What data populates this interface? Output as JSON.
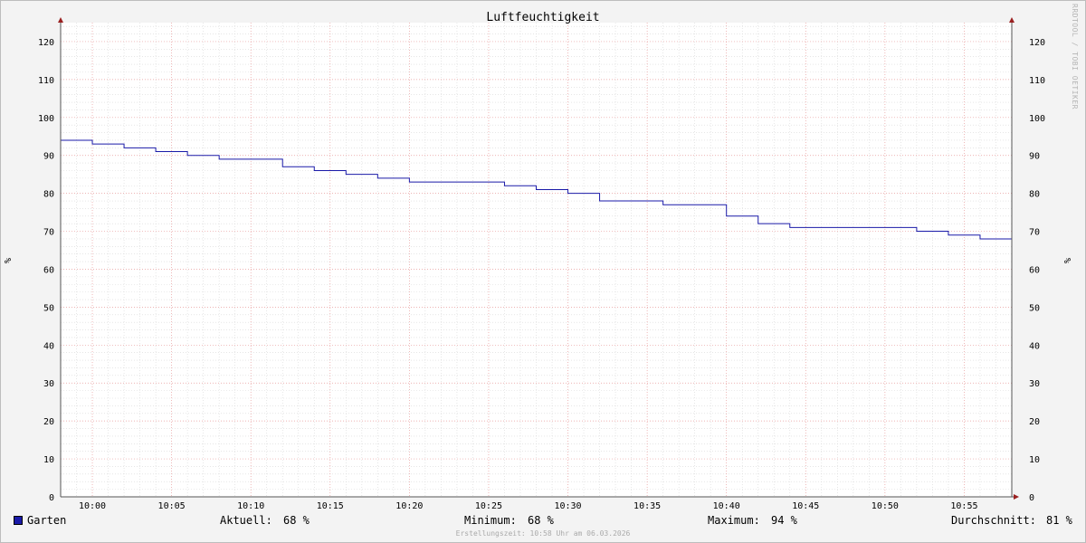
{
  "chart_data": {
    "type": "line",
    "title": "Luftfeuchtigkeit",
    "ylabel": "%",
    "ylim": [
      0,
      125
    ],
    "yticks": [
      0,
      10,
      20,
      30,
      40,
      50,
      60,
      70,
      80,
      90,
      100,
      110,
      120
    ],
    "xlim_minutes": [
      58,
      118
    ],
    "xticks": [
      "10:00",
      "10:05",
      "10:10",
      "10:15",
      "10:20",
      "10:25",
      "10:30",
      "10:35",
      "10:40",
      "10:45",
      "10:50",
      "10:55"
    ],
    "grid": true,
    "series": [
      {
        "name": "Garten",
        "color": "#1a1aa8",
        "step_points": [
          [
            "09:58",
            94
          ],
          [
            "10:00",
            93
          ],
          [
            "10:02",
            92
          ],
          [
            "10:04",
            91
          ],
          [
            "10:06",
            90
          ],
          [
            "10:08",
            89
          ],
          [
            "10:12",
            87
          ],
          [
            "10:14",
            86
          ],
          [
            "10:16",
            85
          ],
          [
            "10:18",
            84
          ],
          [
            "10:20",
            83
          ],
          [
            "10:26",
            82
          ],
          [
            "10:28",
            81
          ],
          [
            "10:30",
            80
          ],
          [
            "10:32",
            78
          ],
          [
            "10:36",
            77
          ],
          [
            "10:40",
            74
          ],
          [
            "10:42",
            72
          ],
          [
            "10:44",
            71
          ],
          [
            "10:52",
            70
          ],
          [
            "10:54",
            69
          ],
          [
            "10:56",
            68
          ],
          [
            "10:58",
            68
          ]
        ]
      }
    ]
  },
  "legend": {
    "series_name": "Garten",
    "current_label": "Aktuell:",
    "current_value": "68 %",
    "min_label": "Minimum:",
    "min_value": "68 %",
    "max_label": "Maximum:",
    "max_value": "94 %",
    "avg_label": "Durchschnitt:",
    "avg_value": "81 %"
  },
  "footer": "Erstellungszeit: 10:58 Uhr am 06.03.2026",
  "watermark": "RRDTOOL / TOBI OETIKER"
}
